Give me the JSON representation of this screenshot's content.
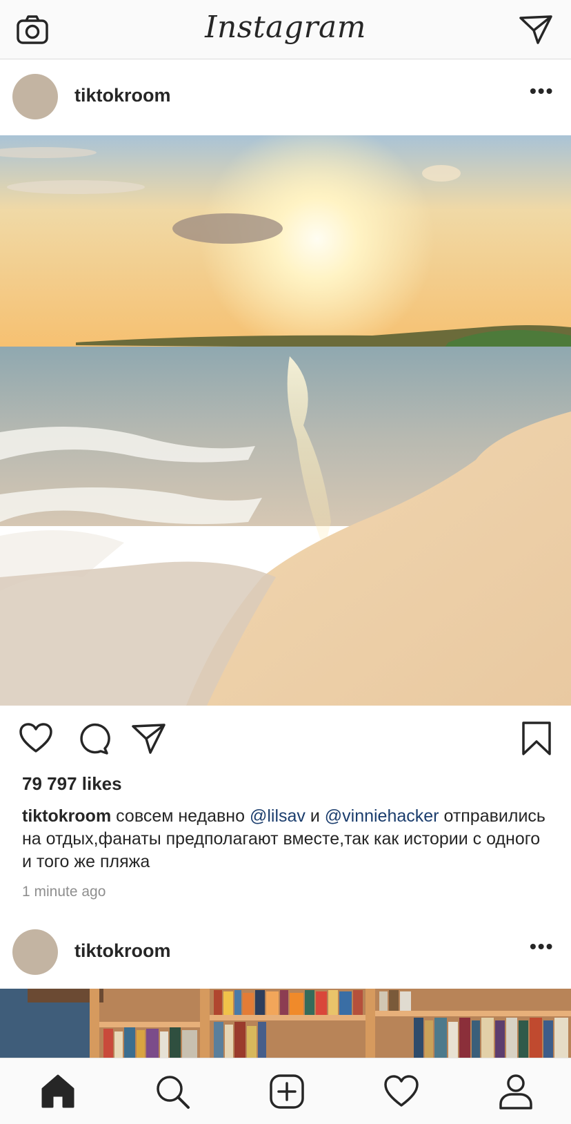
{
  "app": {
    "logo": "Instagram"
  },
  "topbar": {
    "camera_icon": "camera-icon",
    "direct_icon": "paper-plane-icon"
  },
  "posts": [
    {
      "username": "tiktokroom",
      "more_label": "•••",
      "likes": "79 797 likes",
      "caption": {
        "username": "tiktokroom",
        "text_1": " совсем недавно ",
        "mention_1": "@lilsav",
        "text_2": " и ",
        "mention_2": "@vinniehacker",
        "text_3": " отправились на отдых,фанаты предполагают вместе,так как истории с одного и того же пляжа"
      },
      "time": "1 minute ago"
    },
    {
      "username": "tiktokroom",
      "more_label": "•••"
    }
  ],
  "tabbar": {
    "items": [
      "home-icon",
      "search-icon",
      "new-post-icon",
      "activity-heart-icon",
      "profile-icon"
    ]
  },
  "colors": {
    "mention": "#1b3d6d",
    "avatar": "#c3b4a2",
    "time": "#8e8e8e"
  }
}
